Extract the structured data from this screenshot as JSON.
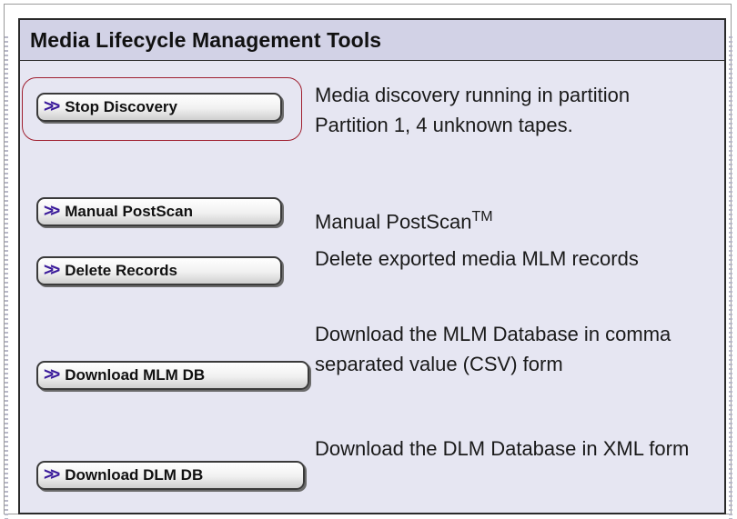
{
  "panel": {
    "title": "Media Lifecycle Management Tools"
  },
  "rows": [
    {
      "button_label": "Stop Discovery",
      "description": "Media discovery running in partition Partition 1, 4 unknown tapes."
    },
    {
      "button_label": "Manual PostScan",
      "description": "Manual PostScan",
      "description_sup": "TM"
    },
    {
      "button_label": "Delete Records",
      "description": "Delete exported media MLM records"
    },
    {
      "button_label": "Download MLM DB",
      "description": "Download the MLM Database in comma separated value (CSV) form"
    },
    {
      "button_label": "Download DLM DB",
      "description": "Download the DLM Database in XML form"
    }
  ],
  "icons": {
    "button_chevron": "double-chevron-right-icon"
  },
  "colors": {
    "panel_bg": "#e6e6f2",
    "header_bg": "#d2d2e6",
    "chevron": "#3a1a9a",
    "highlight_ring": "#a02030"
  }
}
